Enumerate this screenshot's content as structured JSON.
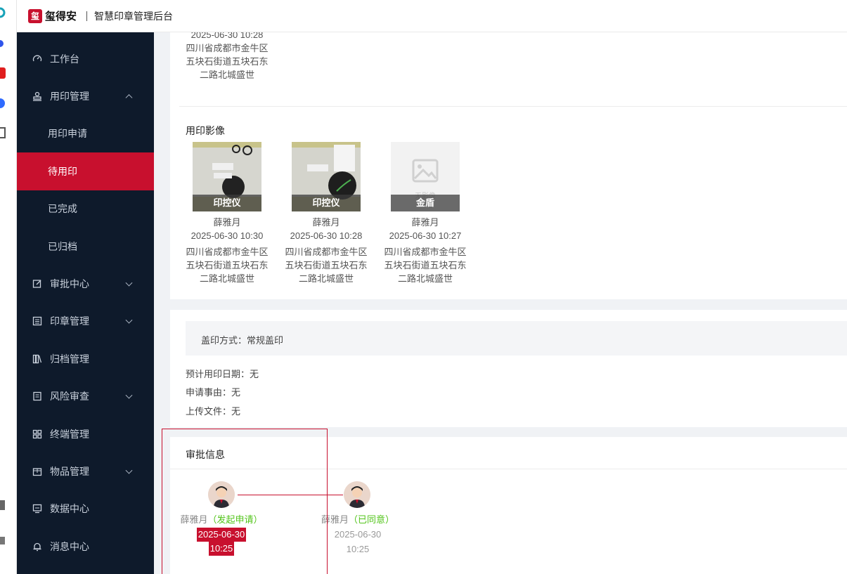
{
  "header": {
    "brand": "玺得安",
    "title": "智慧印章管理后台"
  },
  "sidebar": {
    "items": [
      {
        "label": "工作台",
        "icon": "dashboard-icon"
      },
      {
        "label": "用印管理",
        "icon": "stamp-icon",
        "expanded": true,
        "children": [
          "用印申请",
          "待用印",
          "已完成",
          "已归档"
        ],
        "active_child": "待用印"
      },
      {
        "label": "审批中心",
        "icon": "edit-icon"
      },
      {
        "label": "印章管理",
        "icon": "list-icon"
      },
      {
        "label": "归档管理",
        "icon": "books-icon"
      },
      {
        "label": "风险审查",
        "icon": "shield-icon"
      },
      {
        "label": "终端管理",
        "icon": "grid-icon"
      },
      {
        "label": "物品管理",
        "icon": "box-icon"
      },
      {
        "label": "数据中心",
        "icon": "monitor-icon"
      },
      {
        "label": "消息中心",
        "icon": "bell-icon"
      }
    ]
  },
  "top_partial": {
    "time": "2025-06-30 10:28",
    "addr": [
      "四川省成都市金牛区",
      "五块石街道五块石东",
      "二路北城盛世"
    ]
  },
  "stamp_images": {
    "title": "用印影像",
    "items": [
      {
        "label": "印控仪",
        "name": "薛雅月",
        "time": "2025-06-30 10:30",
        "addr": [
          "四川省成都市金牛区",
          "五块石街道五块石东",
          "二路北城盛世"
        ]
      },
      {
        "label": "印控仪",
        "name": "薛雅月",
        "time": "2025-06-30 10:28",
        "addr": [
          "四川省成都市金牛区",
          "五块石街道五块石东",
          "二路北城盛世"
        ]
      },
      {
        "label": "金盾",
        "name": "薛雅月",
        "time": "2025-06-30 10:27",
        "addr": [
          "四川省成都市金牛区",
          "五块石街道五块石东",
          "二路北城盛世"
        ],
        "placeholder_text": "无影像"
      }
    ]
  },
  "details": {
    "method_label": "盖印方式：常规盖印",
    "expected_date": "预计用印日期：无",
    "reason": "申请事由：无",
    "files": "上传文件：无"
  },
  "approval": {
    "title": "审批信息",
    "steps": [
      {
        "name": "薛雅月",
        "status": "（发起申请）",
        "date": "2025-06-30",
        "time": "10:25"
      },
      {
        "name": "薛雅月",
        "status": "（已同意）",
        "date": "2025-06-30",
        "time": "10:25"
      }
    ]
  },
  "colors": {
    "brand_red": "#c8102e",
    "sidebar_bg": "#0e1a2b",
    "success": "#52c41a"
  }
}
